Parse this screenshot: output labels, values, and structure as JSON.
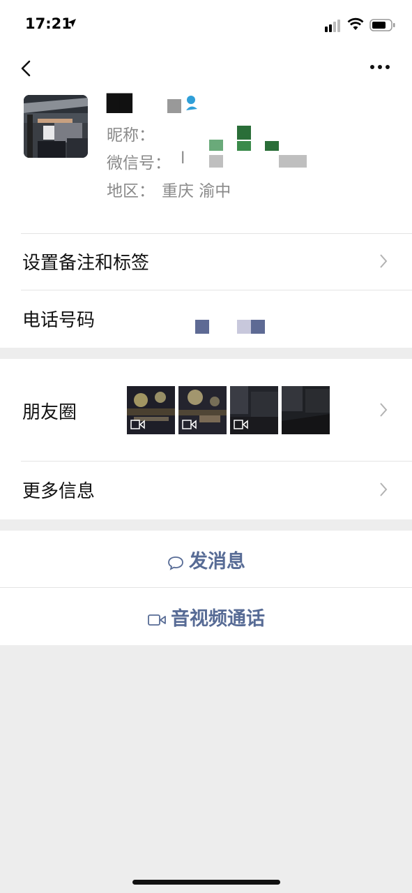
{
  "status": {
    "time": "17:21"
  },
  "profile": {
    "name": "██",
    "nickname_label": "昵称：",
    "wechat_id_label": "微信号：",
    "wechat_id_value": "l",
    "region_label": "地区：",
    "region_value": "重庆 渝中"
  },
  "rows": {
    "remark_label": "设置备注和标签",
    "phone_label": "电话号码",
    "moments_label": "朋友圈",
    "more_info_label": "更多信息"
  },
  "actions": {
    "message_label": "发消息",
    "call_label": "音视频通话"
  },
  "icons": [
    "location-arrow-icon",
    "signal-icon",
    "wifi-icon",
    "battery-icon",
    "back-icon",
    "more-icon",
    "gender-male-icon",
    "chevron-right-icon",
    "video-icon",
    "chat-bubble-icon",
    "video-call-icon"
  ],
  "colors": {
    "accent": "#576b95",
    "background": "#ededed",
    "male": "#2f9fd8"
  }
}
